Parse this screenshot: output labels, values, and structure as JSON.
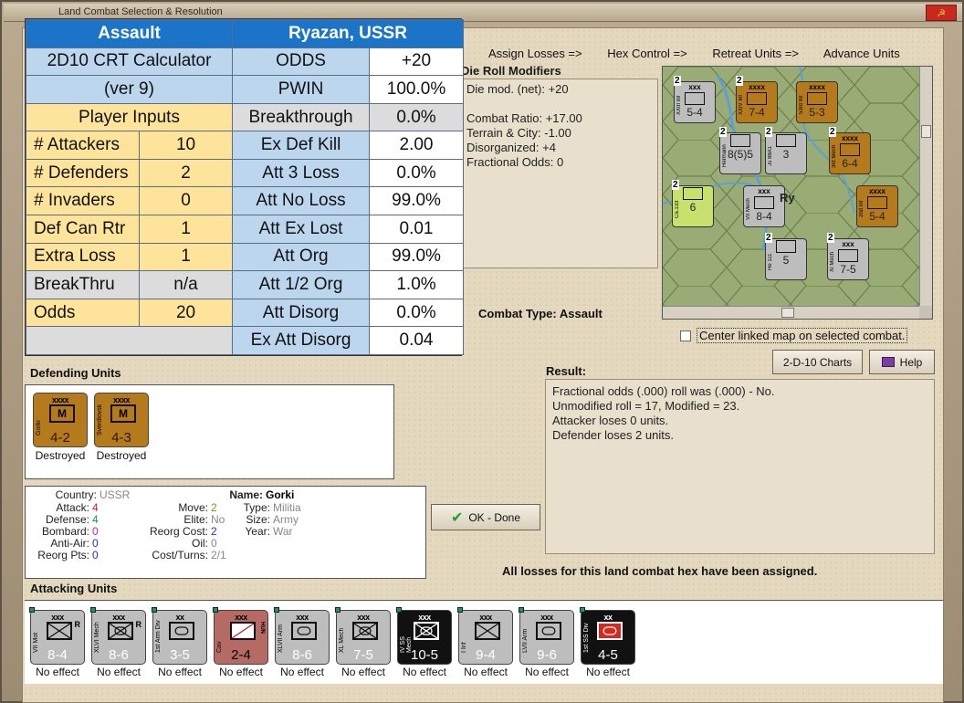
{
  "window": {
    "title": "Land Combat Selection & Resolution"
  },
  "crt": {
    "rows": [
      [
        {
          "t": "Assault",
          "c": "hdr"
        },
        {
          "t": "",
          "c": "hdr"
        },
        {
          "t": "Ryazan, USSR",
          "c": "hdr"
        },
        {
          "t": "",
          "c": "hdr"
        }
      ],
      [
        {
          "t": "2D10 CRT Calculator",
          "c": "lb"
        },
        {
          "t": "",
          "c": "lb"
        },
        {
          "t": "ODDS",
          "c": "lb"
        },
        {
          "t": "+20",
          "c": "wh"
        }
      ],
      [
        {
          "t": "(ver 9)",
          "c": "lb"
        },
        {
          "t": "",
          "c": "lb"
        },
        {
          "t": "PWIN",
          "c": "lb"
        },
        {
          "t": "100.0%",
          "c": "wh"
        }
      ],
      [
        {
          "t": "Player Inputs",
          "c": "yl"
        },
        {
          "t": "",
          "c": "yl"
        },
        {
          "t": "Breakthrough",
          "c": "gy"
        },
        {
          "t": "0.0%",
          "c": "gy"
        }
      ],
      [
        {
          "t": "# Attackers",
          "c": "yl"
        },
        {
          "t": "10",
          "c": "yl"
        },
        {
          "t": "Ex Def Kill",
          "c": "lb"
        },
        {
          "t": "2.00",
          "c": "wh"
        }
      ],
      [
        {
          "t": "# Defenders",
          "c": "yl"
        },
        {
          "t": "2",
          "c": "yl"
        },
        {
          "t": "Att 3 Loss",
          "c": "lb"
        },
        {
          "t": "0.0%",
          "c": "wh"
        }
      ],
      [
        {
          "t": "# Invaders",
          "c": "yl"
        },
        {
          "t": "0",
          "c": "yl"
        },
        {
          "t": "Att No Loss",
          "c": "lb"
        },
        {
          "t": "99.0%",
          "c": "wh"
        }
      ],
      [
        {
          "t": "Def Can Rtr",
          "c": "yl"
        },
        {
          "t": "1",
          "c": "yl"
        },
        {
          "t": "Att Ex Lost",
          "c": "lb"
        },
        {
          "t": "0.01",
          "c": "wh"
        }
      ],
      [
        {
          "t": "Extra Loss",
          "c": "yl"
        },
        {
          "t": "1",
          "c": "yl"
        },
        {
          "t": "Att Org",
          "c": "lb"
        },
        {
          "t": "99.0%",
          "c": "wh"
        }
      ],
      [
        {
          "t": "BreakThru",
          "c": "gy"
        },
        {
          "t": "n/a",
          "c": "gy"
        },
        {
          "t": "Att 1/2 Org",
          "c": "lb"
        },
        {
          "t": "1.0%",
          "c": "wh"
        }
      ],
      [
        {
          "t": "Odds",
          "c": "yl"
        },
        {
          "t": "20",
          "c": "yl"
        },
        {
          "t": "Att Disorg",
          "c": "lb"
        },
        {
          "t": "0.0%",
          "c": "wh"
        }
      ],
      [
        {
          "t": "",
          "c": "gy"
        },
        {
          "t": "",
          "c": "gy"
        },
        {
          "t": "Ex Att Disorg",
          "c": "lb"
        },
        {
          "t": "0.04",
          "c": "wh"
        }
      ]
    ]
  },
  "phases": [
    "Assign Losses =>",
    "Hex Control =>",
    "Retreat Units =>",
    "Advance Units"
  ],
  "drm": {
    "title": "Die Roll Modifiers",
    "lines": [
      "Die mod. (net): +20",
      "",
      "Combat Ratio: +17.00",
      "Terrain & City: -1.00",
      "Disorganized: +4",
      "Fractional Odds: 0"
    ]
  },
  "map": {
    "city": "Ry",
    "counters": [
      {
        "name": "XXIII Inf",
        "size": "xxx",
        "sf": "5-4",
        "color": "gray",
        "stack": "2"
      },
      {
        "name": "XXIV Inf",
        "size": "xxxx",
        "sf": "7-4",
        "color": "brown",
        "stack": "2"
      },
      {
        "name": "53rd Inf",
        "size": "xxxx",
        "sf": "5-3",
        "color": "brown",
        "stack": ""
      },
      {
        "name": "Hermann",
        "size": "",
        "sf": "8(5)5",
        "color": "gray",
        "stack": "2"
      },
      {
        "name": "Ju 88A1",
        "size": "",
        "sf": "3",
        "color": "gray",
        "stack": "2"
      },
      {
        "name": "3rd Mech",
        "size": "xxxx",
        "sf": "6-4",
        "color": "brown",
        "stack": "2"
      },
      {
        "name": "Ca.133",
        "size": "",
        "sf": "6",
        "color": "lime",
        "stack": "2"
      },
      {
        "name": "VII Mech",
        "size": "xxx",
        "sf": "8-4",
        "color": "gray",
        "stack": ""
      },
      {
        "name": "2nd Inf",
        "size": "xxxx",
        "sf": "5-4",
        "color": "brown",
        "stack": ""
      },
      {
        "name": "He 111",
        "size": "",
        "sf": "5",
        "color": "gray",
        "stack": "2"
      },
      {
        "name": "XI Mech",
        "size": "xxx",
        "sf": "7-5",
        "color": "gray",
        "stack": "2"
      }
    ]
  },
  "combat_type": {
    "label": "Combat Type:",
    "value": "Assault"
  },
  "center_linked": {
    "label": "Center linked map on selected combat."
  },
  "buttons": {
    "charts": "2-D-10 Charts",
    "help": "Help",
    "ok": "OK - Done"
  },
  "result": {
    "title": "Result:",
    "lines": [
      "Fractional odds (.000) roll was (.000)  - No.",
      "Unmodified roll = 17, Modified = 23.",
      "Attacker loses 0 units.",
      "Defender loses 2 units."
    ]
  },
  "defending": {
    "title": "Defending Units",
    "units": [
      {
        "name": "Gorki",
        "size": "xxxx",
        "letter": "M",
        "sf": "4-2",
        "status": "Destroyed"
      },
      {
        "name": "Sverdlovsk",
        "size": "xxxx",
        "letter": "M",
        "sf": "4-3",
        "status": "Destroyed"
      }
    ]
  },
  "info": {
    "country_k": "Country:",
    "country_v": "USSR",
    "attack_k": "Attack:",
    "attack_v": "4",
    "defense_k": "Defense:",
    "defense_v": "4",
    "bombard_k": "Bombard:",
    "bombard_v": "0",
    "antiair_k": "Anti-Air:",
    "antiair_v": "0",
    "reorg_k": "Reorg Pts:",
    "reorg_v": "0",
    "move_k": "Move:",
    "move_v": "2",
    "elite_k": "Elite:",
    "elite_v": "No",
    "reorgcost_k": "Reorg Cost:",
    "reorgcost_v": "2",
    "oil_k": "Oil:",
    "oil_v": "0",
    "cost_k": "Cost/Turns:",
    "cost_v": "2/1",
    "name_k": "Name:",
    "name_v": "Gorki",
    "type_k": "Type:",
    "type_v": "Militia",
    "size_k": "Size:",
    "size_v": "Army",
    "year_k": "Year:",
    "year_v": "War"
  },
  "all_losses": "All losses for this land combat hex have been assigned.",
  "attacking": {
    "title": "Attacking Units",
    "units": [
      {
        "name": "VII Mot",
        "size": "xxx",
        "sf": "8-4",
        "status": "No effect",
        "style": "gray",
        "sym": "x",
        "flag": "R"
      },
      {
        "name": "XLVI Mech",
        "size": "xxx",
        "sf": "8-6",
        "status": "No effect",
        "style": "gray",
        "sym": "xo",
        "flag": "R"
      },
      {
        "name": "1st Arm Div",
        "size": "xx",
        "sf": "3-5",
        "status": "No effect",
        "style": "gray",
        "sym": "o",
        "flag": ""
      },
      {
        "name": "Cav",
        "size": "xxx",
        "sf": "2-4",
        "status": "No effect",
        "style": "rose",
        "sym": "slash",
        "flag": "HUN"
      },
      {
        "name": "XLVII Arm",
        "size": "xxx",
        "sf": "8-6",
        "status": "No effect",
        "style": "gray",
        "sym": "o",
        "flag": ""
      },
      {
        "name": "XL Mech",
        "size": "xxx",
        "sf": "7-5",
        "status": "No effect",
        "style": "gray",
        "sym": "xo",
        "flag": ""
      },
      {
        "name": "IV SS Mech",
        "size": "xxx",
        "sf": "10-5",
        "status": "No effect",
        "style": "black",
        "sym": "xo",
        "flag": ""
      },
      {
        "name": "I Inf",
        "size": "xxx",
        "sf": "9-4",
        "status": "No effect",
        "style": "gray",
        "sym": "x",
        "flag": ""
      },
      {
        "name": "LVII Arm",
        "size": "xxx",
        "sf": "9-6",
        "status": "No effect",
        "style": "gray",
        "sym": "o",
        "flag": ""
      },
      {
        "name": "1st SS Div",
        "size": "xx",
        "sf": "4-5",
        "status": "No effect",
        "style": "redblk",
        "sym": "o",
        "flag": ""
      }
    ]
  }
}
